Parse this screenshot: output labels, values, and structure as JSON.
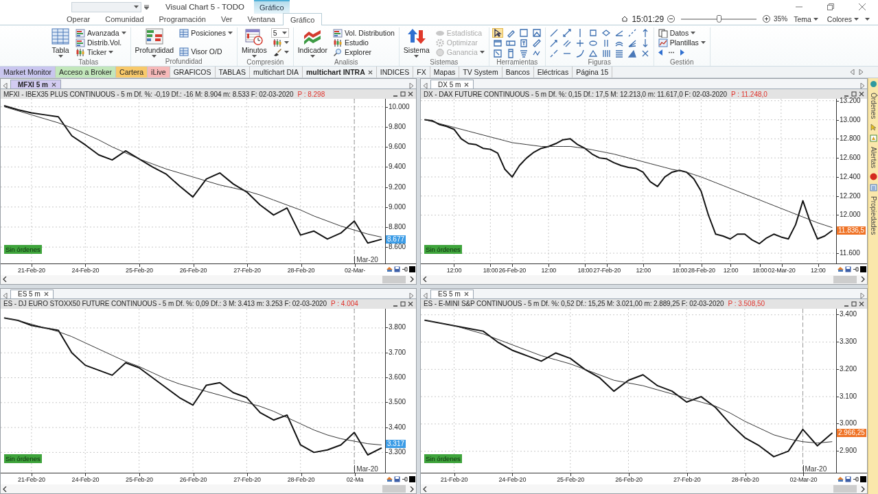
{
  "window": {
    "title": "Visual Chart 5 - TODO",
    "context_tab": "Gráfico"
  },
  "ribbon_tabs": [
    {
      "label": "Operar",
      "selected": false
    },
    {
      "label": "Comunidad",
      "selected": false
    },
    {
      "label": "Programación",
      "selected": false
    },
    {
      "label": "Ver",
      "selected": false
    },
    {
      "label": "Ventana",
      "selected": false
    },
    {
      "label": "Gráfico",
      "selected": true
    }
  ],
  "status_area": {
    "time": "15:01:29",
    "zoom": {
      "level": 0.5,
      "reading": "35%"
    },
    "menus": [
      {
        "label": "Tema"
      },
      {
        "label": "Colores"
      }
    ]
  },
  "ribbon": {
    "groups": [
      {
        "label": "Tablas",
        "items": [
          {
            "kind": "large",
            "label": "Tabla",
            "dropdown": true
          },
          {
            "kind": "small",
            "label": "Avanzada",
            "dropdown": true
          },
          {
            "kind": "small",
            "label": "Distrib.Vol.",
            "dropdown": false
          },
          {
            "kind": "small",
            "label": "Ticker",
            "dropdown": true
          }
        ]
      },
      {
        "label": "Profundidad",
        "items": [
          {
            "kind": "large",
            "label": "Profundidad",
            "dropdown": true
          },
          {
            "kind": "small",
            "label": "Posiciones",
            "dropdown": true
          },
          {
            "kind": "small",
            "label": "Visor O/D",
            "dropdown": false
          }
        ]
      },
      {
        "label": "Compresión",
        "items": [
          {
            "kind": "large",
            "label": "Minutos",
            "dropdown": true
          },
          {
            "kind": "combo",
            "value": "5"
          },
          {
            "kind": "icon",
            "dropdown": true
          },
          {
            "kind": "icon",
            "dropdown": true
          }
        ]
      },
      {
        "label": "Analisis",
        "items": [
          {
            "kind": "large",
            "label": "Indicador",
            "dropdown": true
          },
          {
            "kind": "small",
            "label": "Vol. Distribution",
            "dropdown": false
          },
          {
            "kind": "small",
            "label": "Estudio",
            "dropdown": false
          },
          {
            "kind": "small",
            "label": "Explorer",
            "dropdown": false
          }
        ]
      },
      {
        "label": "Sistemas",
        "items": [
          {
            "kind": "large",
            "label": "Sistema",
            "dropdown": true
          },
          {
            "kind": "small",
            "label": "Estadística",
            "dropdown": false,
            "disabled": true
          },
          {
            "kind": "small",
            "label": "Optimizar",
            "dropdown": false,
            "disabled": true
          },
          {
            "kind": "small",
            "label": "Ganancia",
            "dropdown": true,
            "disabled": true
          }
        ]
      },
      {
        "label": "Herramientas",
        "items": [
          {
            "kind": "tools",
            "tools": [
              {
                "selected": true
              },
              {
                "selected": false
              },
              {
                "selected": false
              },
              {
                "selected": false
              },
              {
                "selected": false
              },
              {
                "selected": false
              },
              {
                "selected": false
              },
              {
                "selected": false
              },
              {
                "selected": false
              },
              {
                "selected": false
              },
              {
                "selected": false
              },
              {
                "selected": false
              }
            ]
          }
        ]
      },
      {
        "label": "Figuras",
        "items": [
          {
            "kind": "figures"
          }
        ]
      },
      {
        "label": "Gestión",
        "items": [
          {
            "kind": "small",
            "label": "Datos",
            "dropdown": true
          },
          {
            "kind": "small",
            "label": "Plantillas",
            "dropdown": true
          },
          {
            "kind": "nav"
          }
        ]
      }
    ]
  },
  "page_tabs": [
    {
      "label": "Market Monitor",
      "selected": false,
      "color": "#c9c6ef"
    },
    {
      "label": "Acceso a Broker",
      "selected": false,
      "color": "#c2e7bb"
    },
    {
      "label": "Cartera",
      "selected": false,
      "color": "#f8c96a"
    },
    {
      "label": "iLive",
      "selected": false,
      "color": "#f6b9b9"
    },
    {
      "label": "GRAFICOS",
      "selected": false
    },
    {
      "label": "TABLAS",
      "selected": false
    },
    {
      "label": "multichart DIA",
      "selected": false
    },
    {
      "label": "multichart INTRA",
      "selected": true
    },
    {
      "label": "INDICES",
      "selected": false
    },
    {
      "label": "FX",
      "selected": false
    },
    {
      "label": "Mapas",
      "selected": false
    },
    {
      "label": "TV System",
      "selected": false
    },
    {
      "label": "Bancos",
      "selected": false
    },
    {
      "label": "Eléctricas",
      "selected": false
    },
    {
      "label": "Página 15",
      "selected": false
    }
  ],
  "charts": [
    {
      "tab": "MFXI 5 m",
      "active": true,
      "info": "MFXI - IBEX35 PLUS CONTINUOUS - 5 m Df. %: -0,19 Df.: -16 M: 8.904 m: 8.533 F: 02-03-2020",
      "price": "P : 8.298",
      "status": "Sin órdenes",
      "last_price": {
        "text": "8.677",
        "color": "#3c9ce6"
      },
      "chart_data": {
        "type": "line",
        "ylim": [
          8440,
          10080
        ],
        "grid": true,
        "categories": [
          null,
          null,
          "21-Feb-20",
          null,
          null,
          null,
          "24-Feb-20",
          null,
          null,
          null,
          "25-Feb-20",
          null,
          null,
          null,
          "26-Feb-20",
          null,
          null,
          null,
          "27-Feb-20",
          null,
          null,
          null,
          "28-Feb-20",
          null,
          null,
          null,
          "02-Mar-",
          null,
          null
        ],
        "yticks": [
          {
            "value": 10000,
            "label": "10.000"
          },
          {
            "value": 9800,
            "label": "9.800"
          },
          {
            "value": 9600,
            "label": "9.600"
          },
          {
            "value": 9400,
            "label": "9.400"
          },
          {
            "value": 9200,
            "label": "9.200"
          },
          {
            "value": 9000,
            "label": "9.000"
          },
          {
            "value": 8800,
            "label": "8.800"
          },
          {
            "value": 8600,
            "label": "8.600"
          }
        ],
        "series": [
          {
            "color": "#111111",
            "values": [
              10010,
              9970,
              9940,
              9920,
              9900,
              9710,
              9620,
              9520,
              9470,
              9560,
              9480,
              9400,
              9330,
              9210,
              9100,
              9280,
              9340,
              9230,
              9150,
              9020,
              8920,
              8990,
              8720,
              8760,
              8680,
              8740,
              8860,
              8640,
              8677
            ]
          },
          {
            "color": "#333333",
            "values": [
              10000,
              9960,
              9920,
              9880,
              9840,
              9790,
              9730,
              9670,
              9600,
              9540,
              9480,
              9430,
              9380,
              9340,
              9300,
              9260,
              9220,
              9190,
              9160,
              9120,
              9070,
              9020,
              8970,
              8910,
              8860,
              8810,
              8770,
              8730,
              8700
            ]
          }
        ],
        "annotations": [
          {
            "text": "Mar-20"
          }
        ]
      }
    },
    {
      "tab": "DX 5 m",
      "active": false,
      "info": "DX - DAX FUTURE CONTINUOUS - 5 m Df. %: 0,15 Df.: 17,5 M: 12.213,0 m: 11.617,0 F: 02-03-2020",
      "price": "P : 11.248,0",
      "status": "Sin órdenes",
      "last_price": {
        "text": "11.836,5",
        "color": "#ef7326"
      },
      "chart_data": {
        "type": "line",
        "ylim": [
          11496,
          13220
        ],
        "grid": true,
        "categories": [
          null,
          null,
          null,
          null,
          "12:00",
          null,
          null,
          null,
          null,
          "18:00",
          null,
          null,
          "26-Feb-20",
          null,
          null,
          null,
          null,
          "12:00",
          null,
          null,
          null,
          null,
          "18:00",
          null,
          null,
          "27-Feb-20",
          null,
          null,
          null,
          null,
          "12:00",
          null,
          null,
          null,
          null,
          "18:00",
          null,
          null,
          "28-Feb-20",
          null,
          null,
          null,
          "12:00",
          null,
          null,
          null,
          "18:00",
          null,
          null,
          "02-Mar-20",
          null,
          null,
          null,
          null,
          "12:00",
          null,
          null
        ],
        "yticks": [
          {
            "value": 13200,
            "label": "13.200"
          },
          {
            "value": 13000,
            "label": "13.000"
          },
          {
            "value": 12800,
            "label": "12.800"
          },
          {
            "value": 12600,
            "label": "12.600"
          },
          {
            "value": 12400,
            "label": "12.400"
          },
          {
            "value": 12200,
            "label": "12.200"
          },
          {
            "value": 12000,
            "label": "12.000"
          },
          {
            "value": 11600,
            "label": "11.600"
          }
        ],
        "series": [
          {
            "color": "#111111",
            "values": [
              13000,
              12990,
              12950,
              12930,
              12900,
              12800,
              12750,
              12740,
              12700,
              12690,
              12650,
              12480,
              12400,
              12520,
              12600,
              12660,
              12700,
              12720,
              12750,
              12790,
              12800,
              12740,
              12700,
              12640,
              12600,
              12590,
              12550,
              12520,
              12500,
              12490,
              12450,
              12350,
              12300,
              12400,
              12450,
              12470,
              12450,
              12380,
              12250,
              12000,
              11800,
              11780,
              11750,
              11800,
              11800,
              11740,
              11700,
              11760,
              11800,
              11770,
              11750,
              11900,
              12150,
              11930,
              11750,
              11780,
              11836
            ]
          },
          {
            "color": "#333333",
            "values": [
              13000,
              12980,
              12960,
              12940,
              12920,
              12900,
              12880,
              12860,
              12840,
              12820,
              12800,
              12780,
              12760,
              12750,
              12740,
              12730,
              12720,
              12720,
              12720,
              12720,
              12720,
              12710,
              12700,
              12685,
              12670,
              12655,
              12640,
              12620,
              12600,
              12580,
              12560,
              12540,
              12520,
              12500,
              12480,
              12465,
              12450,
              12425,
              12400,
              12370,
              12340,
              12310,
              12280,
              12250,
              12220,
              12190,
              12160,
              12130,
              12100,
              12070,
              12040,
              12010,
              11980,
              11950,
              11920,
              11895,
              11870
            ]
          }
        ]
      }
    },
    {
      "tab": "ES 5 m",
      "active": false,
      "info": "ES - DJ EURO STOXX50 FUTURE CONTINUOUS - 5 m Df. %: 0,09 Df.: 3 M: 3.413 m: 3.253 F: 02-03-2020",
      "price": "P : 4.004",
      "status": "Sin órdenes",
      "last_price": {
        "text": "3.317",
        "color": "#3c9ce6"
      },
      "chart_data": {
        "type": "line",
        "ylim": [
          3217,
          3877
        ],
        "grid": true,
        "categories": [
          null,
          null,
          "21-Feb-20",
          null,
          null,
          null,
          "24-Feb-20",
          null,
          null,
          null,
          "25-Feb-20",
          null,
          null,
          null,
          "26-Feb-20",
          null,
          null,
          null,
          "27-Feb-20",
          null,
          null,
          null,
          "28-Feb-20",
          null,
          null,
          null,
          "02-Ma",
          null,
          null
        ],
        "yticks": [
          {
            "value": 3800,
            "label": "3.800"
          },
          {
            "value": 3700,
            "label": "3.700"
          },
          {
            "value": 3600,
            "label": "3.600"
          },
          {
            "value": 3500,
            "label": "3.500"
          },
          {
            "value": 3400,
            "label": "3.400"
          },
          {
            "value": 3300,
            "label": "3.300"
          }
        ],
        "series": [
          {
            "color": "#111111",
            "values": [
              3840,
              3830,
              3810,
              3800,
              3790,
              3700,
              3650,
              3630,
              3610,
              3660,
              3640,
              3600,
              3560,
              3520,
              3490,
              3570,
              3580,
              3540,
              3520,
              3460,
              3430,
              3450,
              3330,
              3300,
              3310,
              3330,
              3380,
              3290,
              3317
            ]
          },
          {
            "color": "#333333",
            "values": [
              3840,
              3830,
              3815,
              3800,
              3785,
              3765,
              3740,
              3715,
              3690,
              3665,
              3645,
              3620,
              3595,
              3575,
              3560,
              3545,
              3530,
              3515,
              3500,
              3485,
              3465,
              3440,
              3415,
              3390,
              3370,
              3355,
              3345,
              3335,
              3330
            ]
          }
        ],
        "annotations": [
          {
            "text": "Mar-20"
          }
        ]
      }
    },
    {
      "tab": "ES 5 m",
      "active": false,
      "info": "ES - E-MINI S&P CONTINUOUS - 5 m Df. %: 0,52 Df.: 15,25 M: 3.021,00 m: 2.889,25 F: 02-03-2020",
      "price": "P : 3.508,50",
      "status": "Sin órdenes",
      "last_price": {
        "text": "2.966,25",
        "color": "#ef7326"
      },
      "chart_data": {
        "type": "line",
        "ylim": [
          2820,
          3422
        ],
        "grid": true,
        "categories": [
          null,
          null,
          "21-Feb-20",
          null,
          null,
          null,
          "24-Feb-20",
          null,
          null,
          null,
          "25-Feb-20",
          null,
          null,
          null,
          "26-Feb-20",
          null,
          null,
          null,
          "27-Feb-20",
          null,
          null,
          null,
          "28-Feb-20",
          null,
          null,
          null,
          "02-Mar-20",
          null,
          null
        ],
        "yticks": [
          {
            "value": 3400,
            "label": "3.400"
          },
          {
            "value": 3300,
            "label": "3.300"
          },
          {
            "value": 3200,
            "label": "3.200"
          },
          {
            "value": 3100,
            "label": "3.100"
          },
          {
            "value": 3000,
            "label": "3.000"
          },
          {
            "value": 2900,
            "label": "2.900"
          }
        ],
        "series": [
          {
            "color": "#111111",
            "values": [
              3380,
              3370,
              3360,
              3350,
              3340,
              3300,
              3270,
              3250,
              3230,
              3260,
              3240,
              3200,
              3170,
              3120,
              3160,
              3180,
              3140,
              3120,
              3080,
              3100,
              3060,
              3000,
              2950,
              2920,
              2880,
              2900,
              2980,
              2920,
              2966
            ]
          },
          {
            "color": "#333333",
            "values": [
              3380,
              3370,
              3360,
              3345,
              3330,
              3310,
              3290,
              3270,
              3250,
              3235,
              3220,
              3200,
              3180,
              3160,
              3150,
              3140,
              3125,
              3110,
              3095,
              3080,
              3065,
              3040,
              3010,
              2985,
              2960,
              2945,
              2935,
              2930,
              2935
            ]
          }
        ],
        "annotations": [
          {
            "text": "Mar-20"
          }
        ]
      }
    }
  ],
  "side_panel": [
    {
      "label": "Órdenes"
    },
    {
      "label": "Alertas"
    },
    {
      "label": "Propiedades"
    }
  ]
}
